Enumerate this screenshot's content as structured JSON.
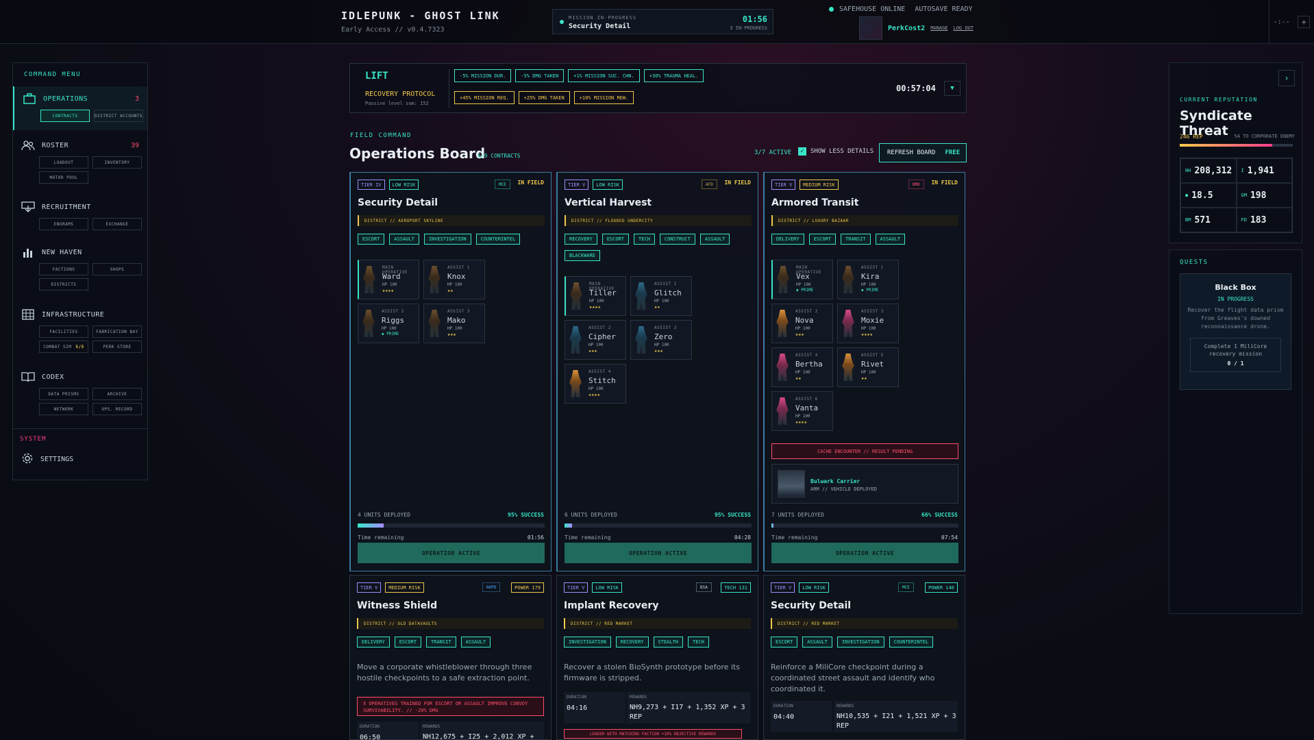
{
  "header": {
    "title": "IDLEPUNK - GHOST LINK",
    "subtitle": "Early Access // v0.4.7323",
    "mission": {
      "label": "MISSION IN-PROGRESS",
      "name": "Security Detail",
      "timer": "01:56",
      "count": "3 IN-PROGRESS"
    },
    "status": {
      "safehouse": "SAFEHOUSE ONLINE",
      "autosave": "AUTOSAVE READY"
    },
    "user": {
      "name": "PerkCost2",
      "manage": "MANAGE",
      "logout": "LOG OUT"
    },
    "corner": {
      "clock": "-:--",
      "plus": "+"
    }
  },
  "sidebar": {
    "heading": "COMMAND MENU",
    "sections": [
      {
        "label": "OPERATIONS",
        "count": "3",
        "icon": "briefcase-icon",
        "subs": [
          "CONTRACTS",
          "DISTRICT ACCOUNTS"
        ]
      },
      {
        "label": "ROSTER",
        "count": "39",
        "icon": "people-icon",
        "subs": [
          "LOADOUT",
          "INVENTORY",
          "MOTOR POOL"
        ]
      },
      {
        "label": "RECRUITMENT",
        "icon": "recruit-icon",
        "subs": [
          "ENGRAMS",
          "EXCHANGE"
        ]
      },
      {
        "label": "NEW HAVEN",
        "icon": "bar-chart-icon",
        "subs": [
          "FACTIONS",
          "SHOPS",
          "DISTRICTS"
        ]
      },
      {
        "label": "INFRASTRUCTURE",
        "icon": "building-icon",
        "subs": [
          "FACILITIES",
          "FABRICATION BAY",
          "COMBAT SIM",
          "PERK STORE"
        ],
        "combat_sim_count": "5/5"
      },
      {
        "label": "CODEX",
        "icon": "book-icon",
        "subs": [
          "DATA PRISMS",
          "ARCHIVE",
          "NETWORK",
          "OPS. RECORD"
        ]
      }
    ],
    "system_label": "SYSTEM",
    "settings_label": "SETTINGS"
  },
  "lift": {
    "name": "LIFT",
    "protocol": "RECOVERY PROTOCOL",
    "level": "Passive level sum: 152",
    "buffs_row1": [
      "-5% MISSION DUR.",
      "-5% DMG TAKEN",
      "+1% MISSION SUC. CHN.",
      "+30% TRAUMA HEAL."
    ],
    "buffs_row2": [
      "+45% MISSION REQ.",
      "+25% DMG TAKEN",
      "+10% MISSION REW."
    ],
    "timer": "00:57:04",
    "dropdown": "▼"
  },
  "board": {
    "eyebrow": "FIELD COMMAND",
    "title": "Operations Board",
    "contracts": "6/9 CONTRACTS",
    "active": "3/7 ACTIVE",
    "show_less": "SHOW LESS DETAILS",
    "refresh": "REFRESH BOARD",
    "refresh_cost": "FREE"
  },
  "cards": [
    {
      "tier": "TIER IV",
      "risk": "LOW RISK",
      "faction": "MCE",
      "status": "IN FIELD",
      "title": "Security Detail",
      "district": "DISTRICT // AEROPORT SKYLINE",
      "roles": [
        "ESCORT",
        "ASSAULT",
        "INVESTIGATION",
        "COUNTERINTEL"
      ],
      "operatives": [
        {
          "role": "MAIN OPERATIVE",
          "name": "Ward",
          "hp": "HP 100",
          "stars": "★★★★"
        },
        {
          "role": "ASSIST 1",
          "name": "Knox",
          "hp": "HP 100",
          "stars": "★★"
        },
        {
          "role": "ASSIST 2",
          "name": "Riggs",
          "hp": "HP 100",
          "prime": "◆ PRIME"
        },
        {
          "role": "ASSIST 3",
          "name": "Mako",
          "hp": "HP 100",
          "stars": "★★★"
        }
      ],
      "deployed": "4 UNITS DEPLOYED",
      "success": "95% SUCCESS",
      "progress": 0.14,
      "time_label": "Time remaining",
      "time": "01:56",
      "button": "OPERATION ACTIVE"
    },
    {
      "tier": "TIER V",
      "risk": "LOW RISK",
      "faction": "AFD",
      "status": "IN FIELD",
      "title": "Vertical Harvest",
      "district": "DISTRICT // FLOODED UNDERCITY",
      "roles": [
        "RECOVERY",
        "ESCORT",
        "TECH",
        "CONSTRUCT",
        "ASSAULT",
        "BLACKWARE"
      ],
      "operatives": [
        {
          "role": "MAIN OPERATIVE",
          "name": "Tiller",
          "hp": "HP 100",
          "stars": "★★★★"
        },
        {
          "role": "ASSIST 1",
          "name": "Glitch",
          "hp": "HP 100",
          "stars": "★★"
        },
        {
          "role": "ASSIST 2",
          "name": "Cipher",
          "hp": "HP 100",
          "stars": "★★★"
        },
        {
          "role": "ASSIST 3",
          "name": "Zero",
          "hp": "HP 100",
          "stars": "★★★"
        },
        {
          "role": "ASSIST 4",
          "name": "Stitch",
          "hp": "HP 100",
          "stars": "★★★★"
        }
      ],
      "deployed": "6 UNITS DEPLOYED",
      "success": "95% SUCCESS",
      "progress": 0.04,
      "time_label": "Time remaining",
      "time": "04:28",
      "button": "OPERATION ACTIVE"
    },
    {
      "tier": "TIER V",
      "risk": "MEDIUM RISK",
      "faction": "NMD",
      "status": "IN FIELD",
      "title": "Armored Transit",
      "district": "DISTRICT // LUXURY BAZAAR",
      "roles": [
        "DELIVERY",
        "ESCORT",
        "TRANSIT",
        "ASSAULT"
      ],
      "operatives": [
        {
          "role": "MAIN OPERATIVE",
          "name": "Vex",
          "hp": "HP 100",
          "prime": "◆ PRIME"
        },
        {
          "role": "ASSIST 1",
          "name": "Kira",
          "hp": "HP 100",
          "prime": "◆ PRIME"
        },
        {
          "role": "ASSIST 2",
          "name": "Nova",
          "hp": "HP 100",
          "stars": "★★★"
        },
        {
          "role": "ASSIST 3",
          "name": "Moxie",
          "hp": "HP 100",
          "stars": "★★★★"
        },
        {
          "role": "ASSIST 4",
          "name": "Bertha",
          "hp": "HP 100",
          "stars": "★★"
        },
        {
          "role": "ASSIST 5",
          "name": "Rivet",
          "hp": "HP 100",
          "stars": "★★"
        },
        {
          "role": "ASSIST 6",
          "name": "Vanta",
          "hp": "HP 100",
          "stars": "★★★★"
        }
      ],
      "cache": "CACHE ENCOUNTER // RESULT PENDING",
      "vehicle": {
        "name": "Bulwark Carrier",
        "desc": "ARM // VEHICLE DEPLOYED"
      },
      "deployed": "7 UNITS DEPLOYED",
      "success": "66% SUCCESS",
      "progress": 0.01,
      "time_label": "Time remaining",
      "time": "07:54",
      "button": "OPERATION ACTIVE"
    },
    {
      "tier": "TIER V",
      "risk": "MEDIUM RISK",
      "faction": "NHPD",
      "power": "POWER 179",
      "title": "Witness Shield",
      "district": "DISTRICT // OLD DATAVAULTS",
      "roles": [
        "DELIVERY",
        "ESCORT",
        "TRANSIT",
        "ASSAULT"
      ],
      "desc": "Move a corporate whistleblower through three hostile checkpoints to a safe extraction point.",
      "warn": "X OPERATIVES TRAINED FOR ESCORT OR ASSAULT IMPROVE CONVOY SURVIVABILITY. // -20% DMG",
      "duration_label": "DURATION",
      "duration": "06:50",
      "rewards_label": "REWARDS",
      "rewards": "NH12,675 + I25 + 2,012 XP +"
    },
    {
      "tier": "TIER V",
      "risk": "LOW RISK",
      "faction": "BSA",
      "power": "TECH 131",
      "title": "Implant Recovery",
      "district": "DISTRICT // RED MARKET",
      "roles": [
        "INVESTIGATION",
        "RECOVERY",
        "STEALTH",
        "TECH"
      ],
      "desc": "Recover a stolen BioSynth prototype before its firmware is stripped.",
      "duration_label": "DURATION",
      "duration": "04:16",
      "rewards_label": "REWARDS",
      "rewards": "NH9,273 + I17 + 1,352 XP + 3 REP",
      "lead": "LEADER WITH MATCHING FACTION +10% OBJECTIVE REWARDS"
    },
    {
      "tier": "TIER V",
      "risk": "LOW RISK",
      "faction": "MCE",
      "power": "POWER 140",
      "title": "Security Detail",
      "district": "DISTRICT // RED MARKET",
      "roles": [
        "ESCORT",
        "ASSAULT",
        "INVESTIGATION",
        "COUNTERINTEL"
      ],
      "desc": "Reinforce a MiliCore checkpoint during a coordinated street assault and identify who coordinated it.",
      "duration_label": "DURATION",
      "duration": "04:40",
      "rewards_label": "REWARDS",
      "rewards": "NH10,535 + I21 + 1,521 XP + 3 REP"
    }
  ],
  "reputation": {
    "heading": "CURRENT REPUTATION",
    "name": "Syndicate Threat",
    "rep": "246 REP",
    "to_next": "54 TO CORPORATE ENEMY",
    "progress": 0.82,
    "resources": [
      {
        "key": "NH",
        "value": "208,312"
      },
      {
        "key": "I",
        "value": "1,941"
      },
      {
        "key": "●",
        "value": "18.5"
      },
      {
        "key": "GM",
        "value": "198"
      },
      {
        "key": "BM",
        "value": "571"
      },
      {
        "key": "FD",
        "value": "183"
      }
    ]
  },
  "quests": {
    "heading": "QUESTS",
    "title": "Black Box",
    "status": "IN PROGRESS",
    "desc": "Recover the flight data prism from Greaves's downed reconnaissance drone.",
    "objective": "Complete 1 MiliCore recovery mission",
    "count": "0 / 1"
  },
  "colors": {
    "accent": "#39e6c8",
    "warning": "#f2c94c",
    "danger": "#ff4d6d",
    "tier": "#a58cff"
  }
}
